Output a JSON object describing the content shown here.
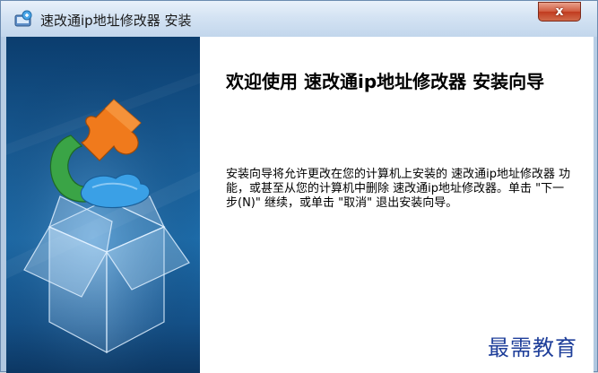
{
  "window": {
    "title": "速改通ip地址修改器 安装",
    "close_label": "x"
  },
  "main": {
    "heading": "欢迎使用 速改通ip地址修改器 安装向导",
    "body": "安装向导将允许更改在您的计算机上安装的 速改通ip地址修改器 功能，或甚至从您的计算机中删除 速改通ip地址修改器。单击 \"下一步(N)\" 继续，或单击 \"取消\" 退出安装向导。"
  },
  "watermark": {
    "text": "最需教育"
  },
  "icons": {
    "app": "installer-app-icon",
    "close": "close-icon",
    "banner": "puzzle-box-banner"
  }
}
